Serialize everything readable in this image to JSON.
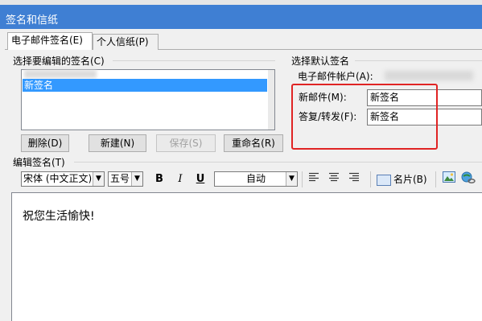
{
  "window": {
    "title": "签名和信纸"
  },
  "tabs": [
    {
      "label": "电子邮件签名(E)",
      "active": true
    },
    {
      "label": "个人信纸(P)",
      "active": false
    }
  ],
  "left_group": {
    "label": "选择要编辑的签名(C)",
    "selected_item": "新签名",
    "buttons": {
      "delete": "删除(D)",
      "new": "新建(N)",
      "save": "保存(S)",
      "rename": "重命名(R)"
    }
  },
  "right_group": {
    "label": "选择默认签名",
    "account_label": "电子邮件帐户(A):",
    "new_messages_label": "新邮件(M):",
    "new_messages_value": "新签名",
    "replies_label": "答复/转发(F):",
    "replies_value": "新签名"
  },
  "editor": {
    "label": "编辑签名(T)",
    "font": "宋体 (中文正文)",
    "size": "五号",
    "color": "自动",
    "business_card_label": "名片(B)",
    "content": "祝您生活愉快!"
  },
  "colors": {
    "titlebar": "#3f7fd3",
    "selection": "#3399ff",
    "highlight_box": "#e02424"
  }
}
